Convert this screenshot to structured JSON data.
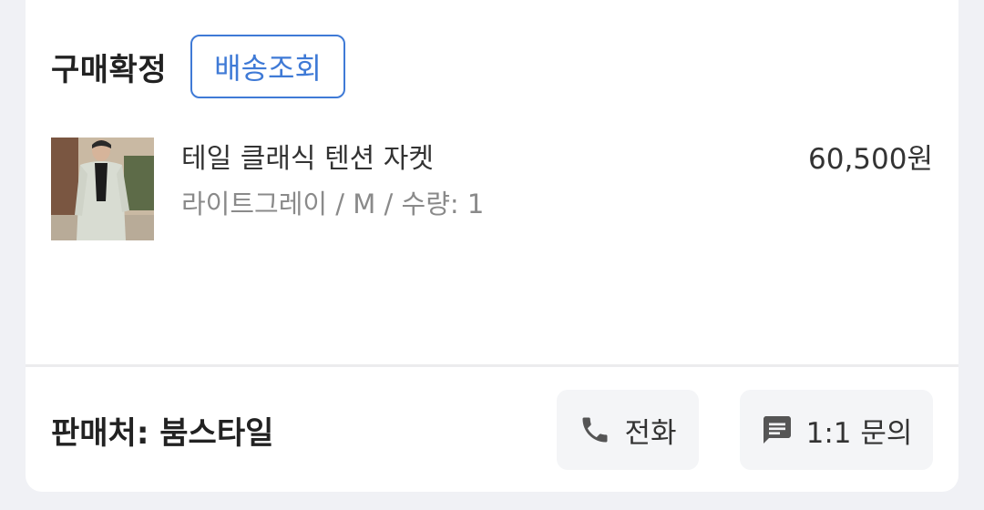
{
  "order": {
    "status": "구매확정",
    "track_label": "배송조회"
  },
  "product": {
    "name": "테일 클래식 텐션 자켓",
    "option": "라이트그레이 / M  / 수량: 1",
    "price": "60,500원"
  },
  "seller": {
    "label": "판매처: 붐스타일",
    "call_label": "전화",
    "inquiry_label": "1:1 문의"
  },
  "icons": {
    "call": "phone-icon",
    "inquiry": "chat-bubble-icon"
  },
  "colors": {
    "accent": "#3f7ad6",
    "background": "#f0f1f5",
    "card": "#ffffff",
    "button_bg": "#f4f5f7"
  }
}
